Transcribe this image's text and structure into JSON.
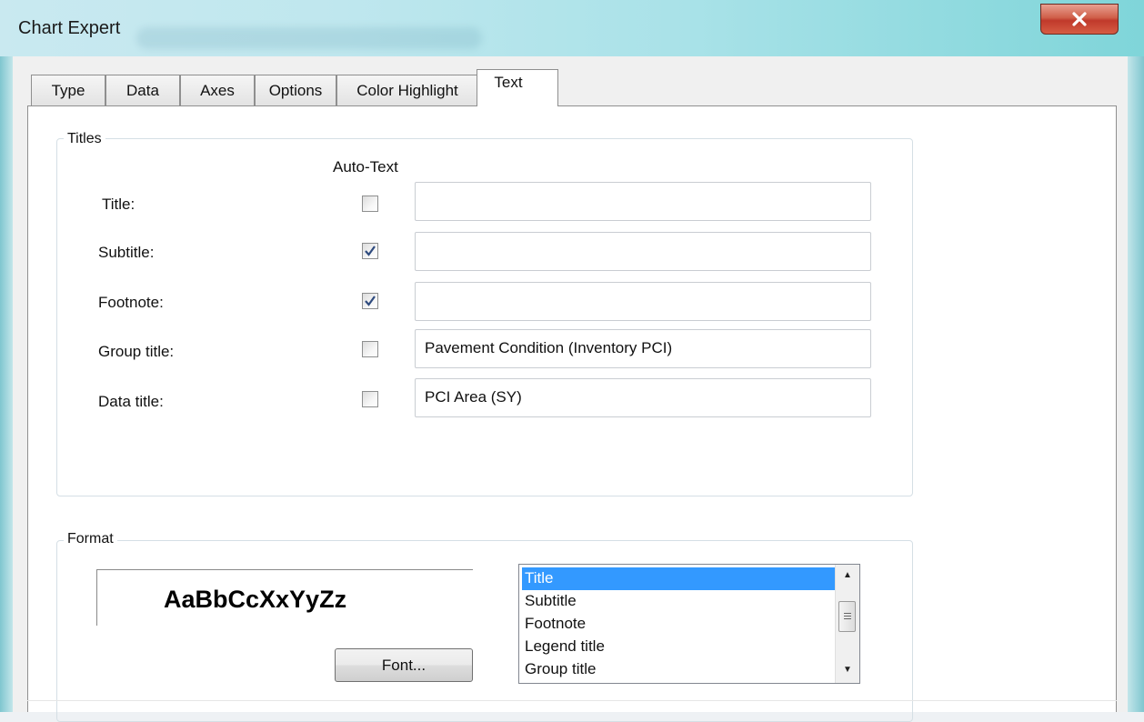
{
  "window": {
    "title": "Chart Expert",
    "close_label": "✕"
  },
  "tabs": [
    {
      "label": "Type",
      "active": false
    },
    {
      "label": "Data",
      "active": false
    },
    {
      "label": "Axes",
      "active": false
    },
    {
      "label": "Options",
      "active": false
    },
    {
      "label": "Color Highlight",
      "active": false
    },
    {
      "label": "Text",
      "active": true
    }
  ],
  "titles": {
    "group_label": "Titles",
    "auto_text_header": "Auto-Text",
    "rows": [
      {
        "label": "Title:",
        "auto_text": false,
        "value": ""
      },
      {
        "label": "Subtitle:",
        "auto_text": true,
        "value": ""
      },
      {
        "label": "Footnote:",
        "auto_text": true,
        "value": ""
      },
      {
        "label": "Group title:",
        "auto_text": false,
        "value": "Pavement Condition (Inventory PCI)"
      },
      {
        "label": "Data title:",
        "auto_text": false,
        "value": "PCI Area (SY)"
      }
    ]
  },
  "format": {
    "group_label": "Format",
    "sample_text": "AaBbCcXxYyZz",
    "font_button": "Font...",
    "list_items": [
      "Title",
      "Subtitle",
      "Footnote",
      "Legend title",
      "Group title"
    ],
    "selected_item": "Title"
  },
  "colors": {
    "selection": "#3399ff",
    "check": "#2e4a7e"
  }
}
